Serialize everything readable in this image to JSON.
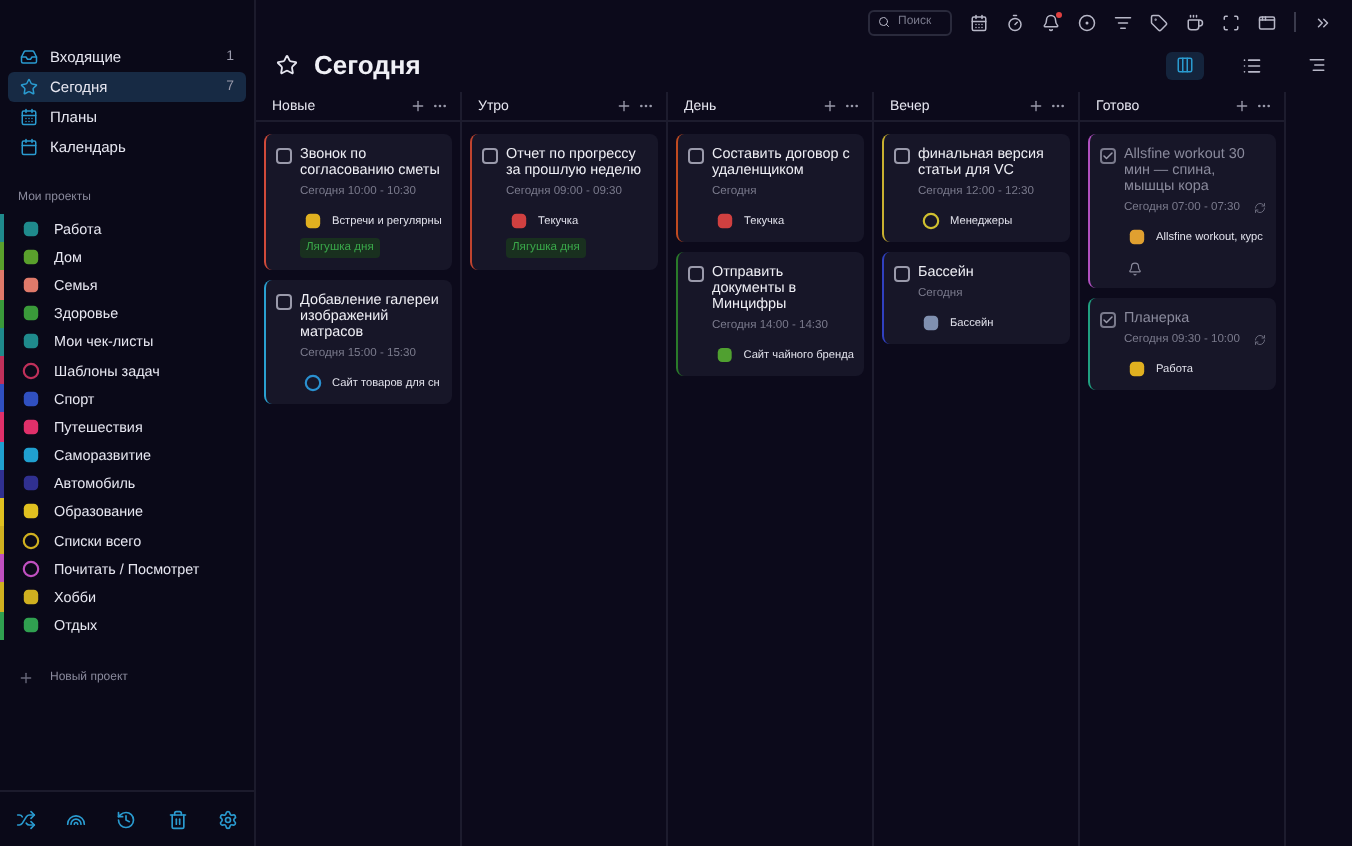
{
  "sidebar": {
    "nav": [
      {
        "label": "Входящие",
        "count": "1",
        "selected": false
      },
      {
        "label": "Сегодня",
        "count": "7",
        "selected": true
      },
      {
        "label": "Планы",
        "selected": false
      },
      {
        "label": "Календарь",
        "selected": false
      }
    ],
    "projects_heading": "Мои проекты",
    "projects": [
      {
        "label": "Работа",
        "color": "#1f8a8c",
        "kind": "emoji"
      },
      {
        "label": "Дом",
        "color": "#5aa02c",
        "kind": "emoji"
      },
      {
        "label": "Семья",
        "color": "#e07a6a",
        "kind": "emoji"
      },
      {
        "label": "Здоровье",
        "color": "#3a9a3a",
        "kind": "emoji"
      },
      {
        "label": "Мои чек-листы",
        "color": "#1f8a8c",
        "kind": "emoji"
      },
      {
        "label": "Шаблоны задач",
        "color": "#c0305a",
        "kind": "ring"
      },
      {
        "label": "Спорт",
        "color": "#3050c0",
        "kind": "emoji"
      },
      {
        "label": "Путешествия",
        "color": "#e0306a",
        "kind": "emoji"
      },
      {
        "label": "Саморазвитие",
        "color": "#20a0d0",
        "kind": "emoji"
      },
      {
        "label": "Автомобиль",
        "color": "#303090",
        "kind": "emoji"
      },
      {
        "label": "Образование",
        "color": "#e0c020",
        "kind": "emoji"
      },
      {
        "label": "Списки всего",
        "color": "#d0b020",
        "kind": "ring"
      },
      {
        "label": "Почитать / Посмотрет",
        "color": "#c050c0",
        "kind": "ring"
      },
      {
        "label": "Хобби",
        "color": "#d0b020",
        "kind": "emoji"
      },
      {
        "label": "Отдых",
        "color": "#30a050",
        "kind": "emoji"
      }
    ],
    "new_project": "Новый проект"
  },
  "toolbar": {
    "search": {
      "placeholder": "Поиск"
    }
  },
  "title": "Сегодня",
  "columns": [
    {
      "title": "Новые",
      "cards": [
        {
          "title": "Звонок по согласованию сметы",
          "time": "Сегодня 10:00 - 10:30",
          "project": {
            "name": "Встречи и регулярны",
            "kind": "emoji",
            "color": "#e0b020"
          },
          "tag": "Лягушка дня",
          "done": false,
          "color": "#d04a3a"
        },
        {
          "title": "Добавление галереи изображений матрасов",
          "time": "Сегодня 15:00 - 15:30",
          "project": {
            "name": "Сайт товаров для сн",
            "kind": "ring",
            "color": "#2a90d0"
          },
          "done": false,
          "color": "#2aa0d0"
        }
      ]
    },
    {
      "title": "Утро",
      "cards": [
        {
          "title": "Отчет по прогрессу за прошлую неделю",
          "time": "Сегодня 09:00 - 09:30",
          "project": {
            "name": "Текучка",
            "kind": "emoji",
            "color": "#d04040"
          },
          "tag": "Лягушка дня",
          "done": false,
          "color": "#c0442f"
        }
      ]
    },
    {
      "title": "День",
      "cards": [
        {
          "title": "Составить договор с удаленщиком",
          "time": "Сегодня",
          "project": {
            "name": "Текучка",
            "kind": "emoji",
            "color": "#d04040"
          },
          "done": false,
          "color": "#c04a20"
        },
        {
          "title": "Отправить документы в Минцифры",
          "time": "Сегодня 14:00 - 14:30",
          "project": {
            "name": "Сайт чайного бренда",
            "kind": "emoji",
            "color": "#50a030"
          },
          "done": false,
          "color": "#2a7a2a"
        }
      ]
    },
    {
      "title": "Вечер",
      "cards": [
        {
          "title": "финальная версия статьи для VC",
          "time": "Сегодня 12:00 - 12:30",
          "project": {
            "name": "Менеджеры",
            "kind": "ring",
            "color": "#d0c030"
          },
          "done": false,
          "color": "#c8b030"
        },
        {
          "title": "Бассейн",
          "time": "Сегодня",
          "project": {
            "name": "Бассейн",
            "kind": "emoji",
            "color": "#8090b0"
          },
          "done": false,
          "color": "#3040c0"
        }
      ]
    },
    {
      "title": "Готово",
      "cards": [
        {
          "title": "Allsfine workout 30 мин — спина, мышцы кора",
          "time": "Сегодня 07:00 - 07:30",
          "repeat": true,
          "project": {
            "name": "Allsfine workout, курс",
            "kind": "emoji",
            "color": "#e0a030"
          },
          "bell": true,
          "done": true,
          "color": "#b050c0"
        },
        {
          "title": "Планерка",
          "time": "Сегодня 09:30 - 10:00",
          "repeat": true,
          "project": {
            "name": "Работа",
            "kind": "emoji",
            "color": "#e0b020"
          },
          "done": true,
          "color": "#20a080"
        }
      ]
    }
  ]
}
